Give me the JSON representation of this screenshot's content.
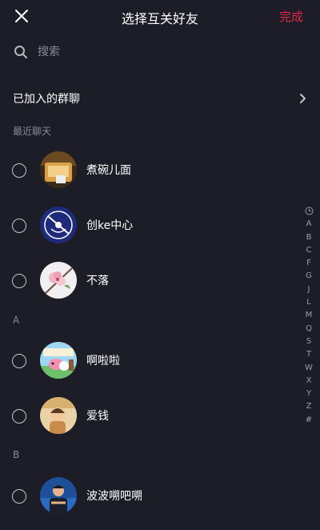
{
  "header": {
    "title": "选择互关好友",
    "done_label": "完成",
    "done_color": "#e0284a"
  },
  "search": {
    "placeholder": "搜索"
  },
  "joined_groups": {
    "label": "已加入的群聊"
  },
  "sections": [
    {
      "label": "最近聊天"
    },
    {
      "label": "A"
    },
    {
      "label": "B"
    }
  ],
  "contacts": [
    {
      "name": "煮碗儿面",
      "avatar": "avatar-kitchen"
    },
    {
      "name": "创ke中心",
      "avatar": "avatar-logo"
    },
    {
      "name": "不落",
      "avatar": "avatar-flower"
    },
    {
      "name": "啊啦啦",
      "avatar": "avatar-cartoon"
    },
    {
      "name": "爱钱",
      "avatar": "avatar-child"
    },
    {
      "name": "波波嗍吧嗍",
      "avatar": "avatar-man"
    }
  ],
  "alpha_index": [
    "A",
    "B",
    "C",
    "F",
    "G",
    "J",
    "L",
    "M",
    "Q",
    "S",
    "T",
    "W",
    "X",
    "Y",
    "Z",
    "#"
  ]
}
